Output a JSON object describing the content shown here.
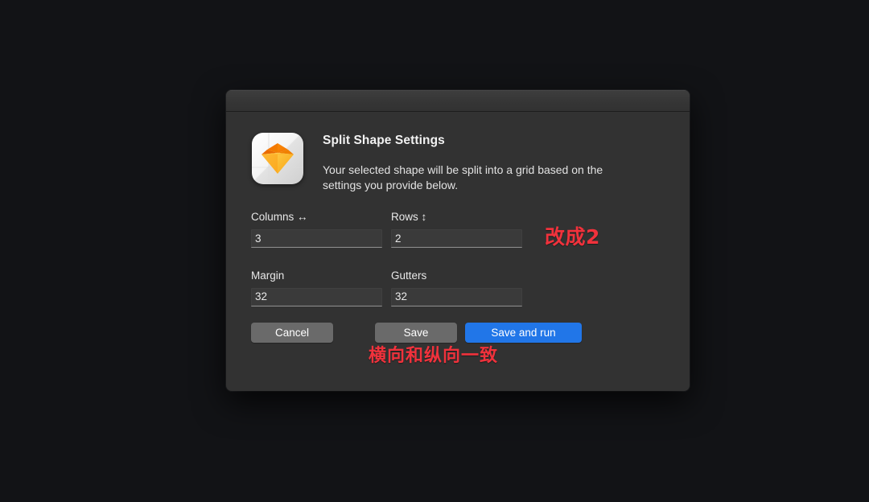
{
  "window": {
    "titlebar_title": ""
  },
  "header": {
    "app_icon_name": "sketch-app-icon",
    "title": "Split Shape Settings",
    "description": "Your selected shape will be split into a grid based on the settings you provide below."
  },
  "form": {
    "fields": [
      {
        "label": "Columns ↔",
        "value": "3",
        "name": "columns"
      },
      {
        "label": "Rows ↕",
        "value": "2",
        "name": "rows"
      },
      {
        "label": "Margin",
        "value": "32",
        "name": "margin"
      },
      {
        "label": "Gutters",
        "value": "32",
        "name": "gutters"
      }
    ]
  },
  "buttons": {
    "cancel": "Cancel",
    "save": "Save",
    "save_and_run": "Save and run"
  },
  "annotations": [
    {
      "text": "改成2",
      "name": "annotation-change-to-2"
    },
    {
      "text": "横向和纵向一致",
      "name": "annotation-horizontal-vertical-same"
    }
  ],
  "colors": {
    "background": "#121316",
    "dialog_body": "#323232",
    "titlebar": "#3a3a3a",
    "primary_button": "#2176e8",
    "secondary_button": "#6a6a6a",
    "annotation_red": "#f0323c",
    "input_background": "#3a3a3a"
  }
}
